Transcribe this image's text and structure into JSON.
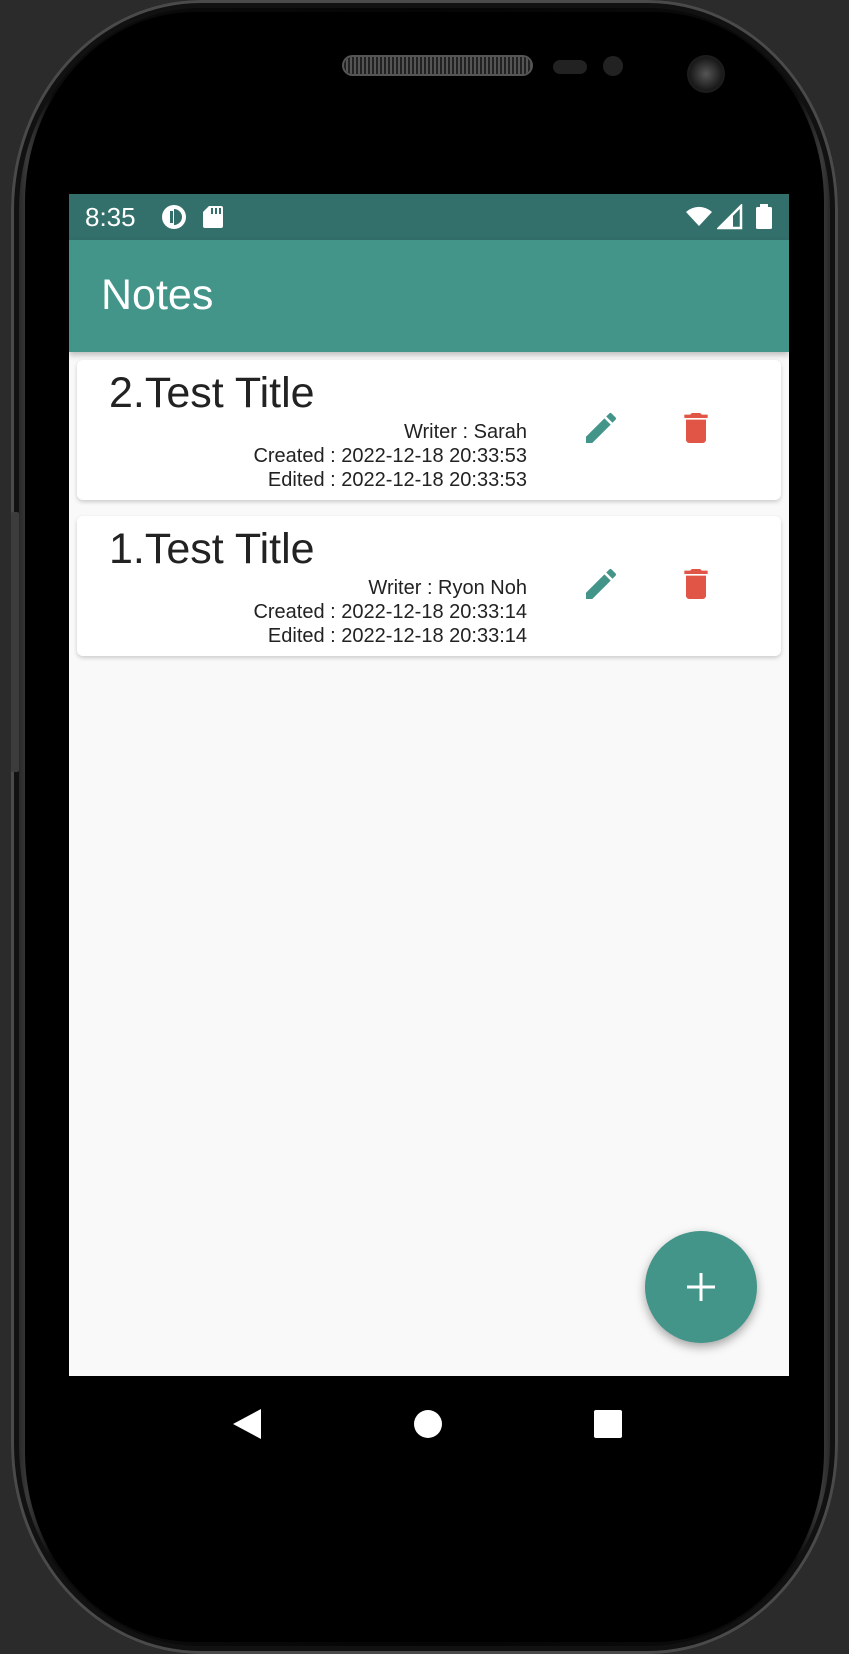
{
  "status_bar": {
    "time": "8:35",
    "left_icons": [
      "data-saver-icon",
      "sd-card-icon"
    ],
    "right_icons": [
      "wifi-icon",
      "cell-signal-icon",
      "battery-icon"
    ]
  },
  "app_bar": {
    "title": "Notes"
  },
  "notes": [
    {
      "title": "2.Test Title",
      "writer": "Writer : Sarah",
      "created": "Created : 2022-12-18 20:33:53",
      "edited": "Edited : 2022-12-18 20:33:53"
    },
    {
      "title": "1.Test Title",
      "writer": "Writer : Ryon Noh",
      "created": "Created : 2022-12-18 20:33:14",
      "edited": "Edited : 2022-12-18 20:33:14"
    }
  ],
  "actions": {
    "edit_icon": "pencil-icon",
    "delete_icon": "trash-icon",
    "fab_icon": "plus-icon"
  },
  "navigation": [
    "back-icon",
    "home-icon",
    "recents-icon"
  ],
  "colors": {
    "primary": "#429588",
    "primary_dark": "#34706b",
    "delete": "#e05545",
    "background": "#f9f9f9"
  }
}
